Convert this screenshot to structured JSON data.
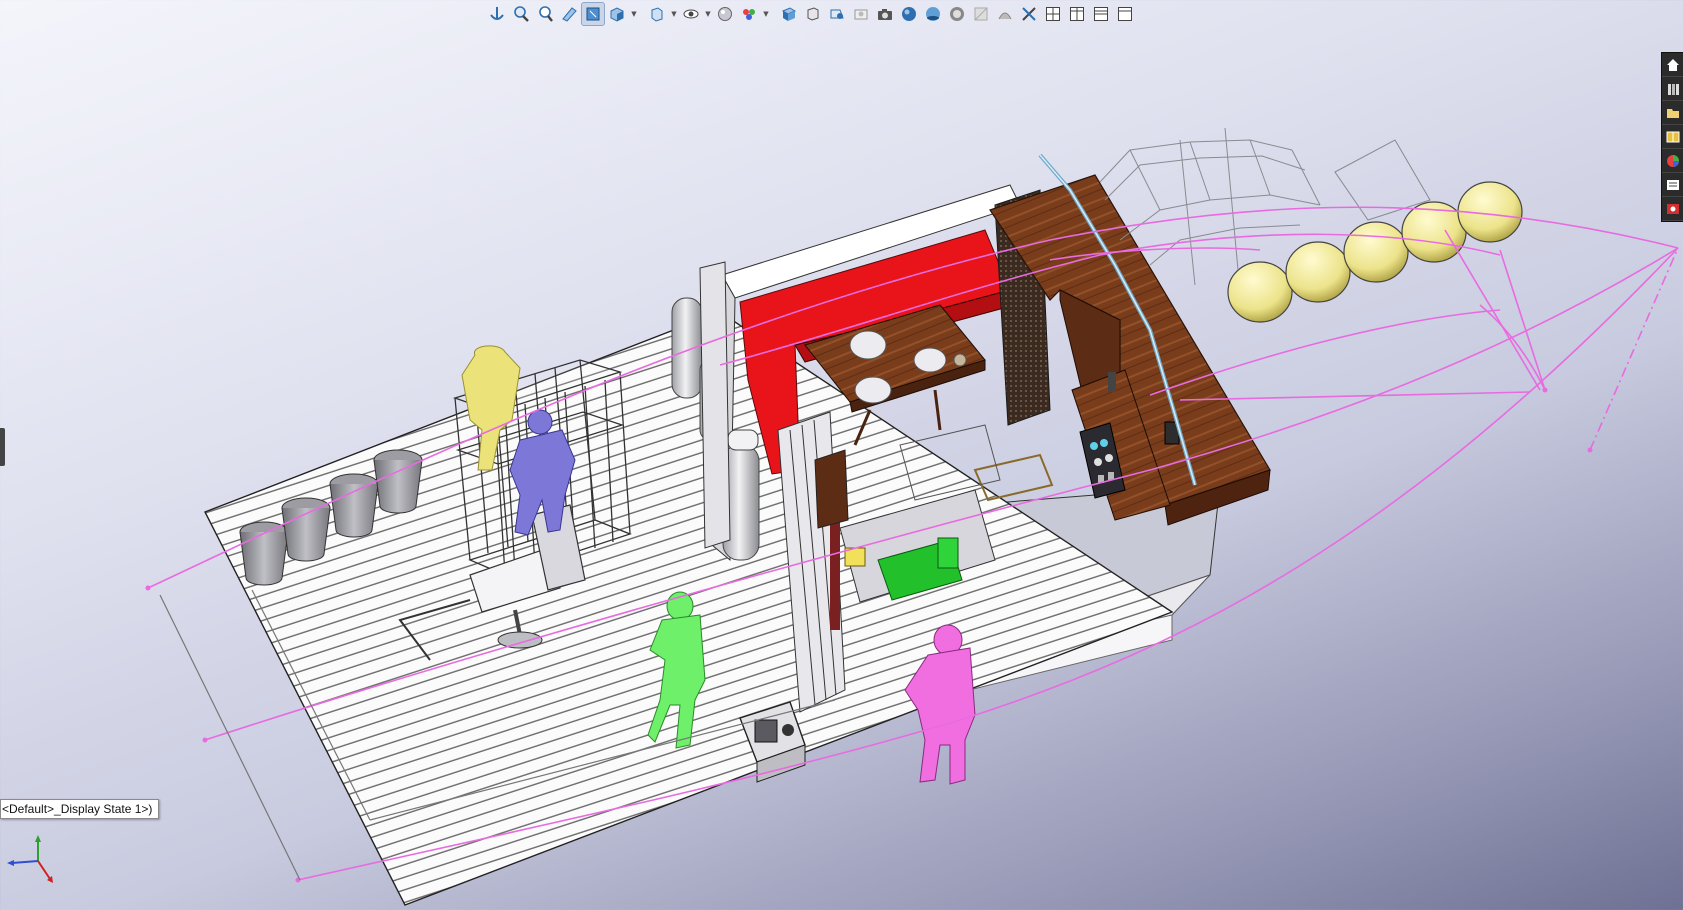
{
  "viewport": {
    "config_label": "<Default>_Display State 1>)"
  },
  "toolbar": {
    "items": [
      {
        "icon": "zoom-to-fit-icon"
      },
      {
        "icon": "zoom-to-area-icon"
      },
      {
        "icon": "previous-view-icon"
      },
      {
        "icon": "section-view-icon"
      },
      {
        "icon": "dynamic-annotation-view-icon"
      },
      {
        "icon": "view-orientation-icon"
      },
      {
        "icon": "display-style-icon"
      },
      {
        "icon": "hide-show-items-icon"
      },
      {
        "icon": "edit-appearance-icon"
      },
      {
        "icon": "apply-scene-icon"
      },
      {
        "icon": "view-settings-icon"
      },
      {
        "icon": "shadows-icon"
      },
      {
        "icon": "perspective-icon"
      },
      {
        "icon": "cartoon-icon"
      },
      {
        "icon": "camera-icon"
      },
      {
        "icon": "sphere-icon"
      },
      {
        "icon": "ambient-occlusion-icon"
      },
      {
        "icon": "realview-icon"
      },
      {
        "icon": "texture-icon"
      },
      {
        "icon": "decal-icon"
      },
      {
        "icon": "single-viewport-icon"
      },
      {
        "icon": "two-viewport-vertical-icon"
      },
      {
        "icon": "two-viewport-horizontal-icon"
      },
      {
        "icon": "four-viewport-icon"
      }
    ]
  },
  "task_pane": {
    "items": [
      {
        "icon": "home-icon"
      },
      {
        "icon": "design-library-icon"
      },
      {
        "icon": "file-explorer-icon"
      },
      {
        "icon": "view-palette-icon"
      },
      {
        "icon": "appearances-icon"
      },
      {
        "icon": "custom-properties-icon"
      },
      {
        "icon": "forum-icon"
      }
    ]
  },
  "colors": {
    "sketch": "#e86be0",
    "seat_red": "#e8141a",
    "wood": "#7a3d1c",
    "buoy": "#f2ea9a",
    "mannequin_yellow": "#ece27a",
    "mannequin_blue": "#7d78d8",
    "mannequin_green": "#6ef06a",
    "mannequin_pink": "#f06ee0",
    "engine_green": "#22c02a"
  }
}
